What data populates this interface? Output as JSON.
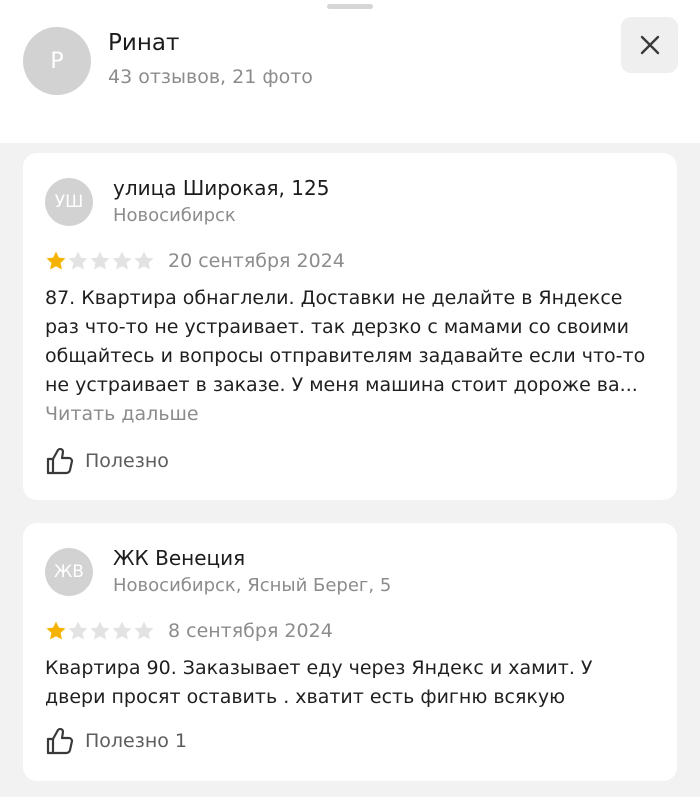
{
  "header": {
    "avatar_letter": "Р",
    "name": "Ринат",
    "stats": "43 отзывов, 21 фото"
  },
  "reviews": [
    {
      "avatar_initials": "УШ",
      "place": "улица Широкая, 125",
      "address": "Новосибирск",
      "rating": 1,
      "max_rating": 5,
      "date": "20 сентября 2024",
      "text": "87. Квартира обнаглели. Доставки не делайте в Яндексе\nраз что-то не устраивает. так дерзко с мамами со своими\nобщайтесь и вопросы отправителям задавайте если что-то\nне устраивает в заказе. У меня машина стоит дороже ва...",
      "read_more": "Читать дальше",
      "useful_label": "Полезно",
      "useful_count": ""
    },
    {
      "avatar_initials": "ЖВ",
      "place": "ЖК Венеция",
      "address": "Новосибирск, Ясный Берег, 5",
      "rating": 1,
      "max_rating": 5,
      "date": "8 сентября 2024",
      "text": "Квартира 90. Заказывает еду через Яндекс и хамит. У\nдвери просят оставить . хватит есть фигню всякую",
      "useful_label": "Полезно",
      "useful_count": "1"
    }
  ],
  "colors": {
    "star_filled": "#f5b300",
    "star_empty": "#e3e3e3",
    "background": "#f2f2f2"
  },
  "icons": {
    "close": "close-icon",
    "like": "thumbs-up-icon",
    "star": "star-icon"
  }
}
